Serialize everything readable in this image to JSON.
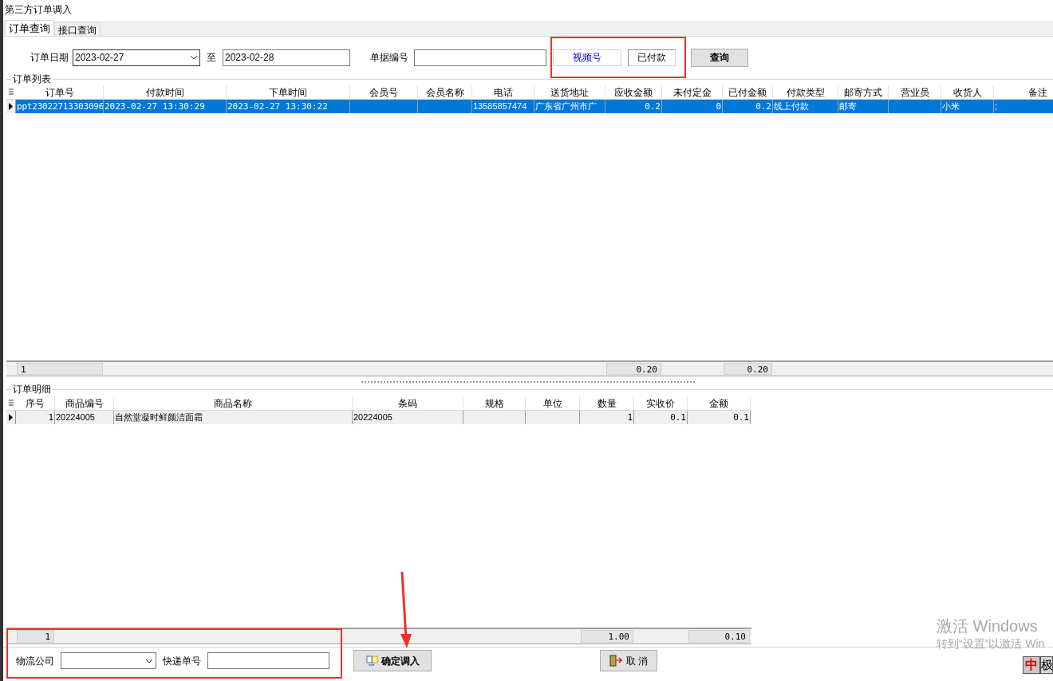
{
  "window": {
    "title": "第三方订单调入"
  },
  "tabs": [
    {
      "label": "订单查询",
      "selected": true
    },
    {
      "label": "接口查询",
      "selected": false
    }
  ],
  "filter": {
    "date_label": "订单日期",
    "date_from": "2023-02-27",
    "to_label": "至",
    "date_to": "2023-02-28",
    "doc_label": "单据编号",
    "channel": "视频号",
    "pay_status": "已付款",
    "query_button": "查询"
  },
  "orders": {
    "title": "订单列表",
    "columns": [
      {
        "label": "订单号",
        "kind": "text",
        "total": "1"
      },
      {
        "label": "付款时间",
        "kind": "text"
      },
      {
        "label": "下单时间",
        "kind": "text"
      },
      {
        "label": "会员号",
        "kind": "text"
      },
      {
        "label": "会员名称",
        "kind": "text"
      },
      {
        "label": "电话",
        "kind": "text"
      },
      {
        "label": "送货地址",
        "kind": "text"
      },
      {
        "label": "应收金额",
        "kind": "number",
        "total": "0.20"
      },
      {
        "label": "未付定金",
        "kind": "number"
      },
      {
        "label": "已付金额",
        "kind": "number",
        "total": "0.20"
      },
      {
        "label": "付款类型",
        "kind": "text"
      },
      {
        "label": "邮寄方式",
        "kind": "text"
      },
      {
        "label": "营业员",
        "kind": "text"
      },
      {
        "label": "收货人",
        "kind": "text"
      },
      {
        "label": "备注",
        "kind": "text"
      }
    ],
    "rows": [
      {
        "selected": true,
        "cells": [
          "ppt23022713303096",
          "2023-02-27 13:30:29",
          "2023-02-27 13:30:22",
          null,
          null,
          "13585857474",
          "广东省广州市广",
          "0.2",
          "0",
          "0.2",
          "线上付款",
          "邮寄",
          null,
          "小米",
          ";"
        ]
      }
    ]
  },
  "details": {
    "title": "订单明细",
    "columns": [
      {
        "label": "序号",
        "kind": "number",
        "total": "1"
      },
      {
        "label": "商品编号",
        "kind": "text"
      },
      {
        "label": "商品名称",
        "kind": "text"
      },
      {
        "label": "条码",
        "kind": "text"
      },
      {
        "label": "规格",
        "kind": "text"
      },
      {
        "label": "单位",
        "kind": "text"
      },
      {
        "label": "数量",
        "kind": "number",
        "total": "1.00"
      },
      {
        "label": "实收价",
        "kind": "number"
      },
      {
        "label": "金额",
        "kind": "number",
        "total": "0.10"
      }
    ],
    "rows": [
      {
        "selected": false,
        "cells": [
          "1",
          "20224005",
          "自然堂凝时鲜颜洁面霜",
          "20224005",
          null,
          null,
          "1",
          "0.1",
          "0.1"
        ]
      }
    ]
  },
  "bottom": {
    "logistics_label": "物流公司",
    "tracking_label": "快递单号",
    "confirm_button": "确定调入",
    "cancel_button": "取 消"
  },
  "activation": {
    "title": "激活 Windows",
    "subtitle": "转到“设置”以激活 Win"
  },
  "ime": {
    "mode": "中",
    "shape": "极"
  }
}
